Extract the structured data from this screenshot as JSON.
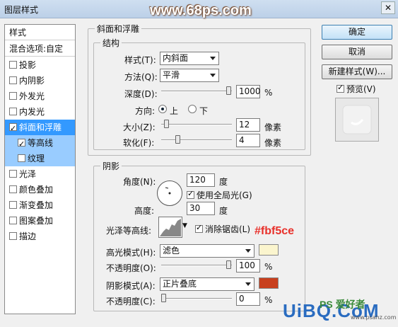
{
  "window": {
    "title": "图层样式",
    "watermark_top": "www.68ps.com",
    "close_glyph": "✕"
  },
  "left": {
    "header": "样式",
    "blend": "混合选项:自定",
    "items": [
      {
        "label": "投影",
        "checked": false
      },
      {
        "label": "内阴影",
        "checked": false
      },
      {
        "label": "外发光",
        "checked": false
      },
      {
        "label": "内发光",
        "checked": false
      },
      {
        "label": "斜面和浮雕",
        "checked": true
      },
      {
        "label": "等高线",
        "checked": true
      },
      {
        "label": "纹理",
        "checked": false
      },
      {
        "label": "光泽",
        "checked": false
      },
      {
        "label": "颜色叠加",
        "checked": false
      },
      {
        "label": "渐变叠加",
        "checked": false
      },
      {
        "label": "图案叠加",
        "checked": false
      },
      {
        "label": "描边",
        "checked": false
      }
    ]
  },
  "buttons": {
    "ok": "确定",
    "cancel": "取消",
    "new_style": "新建样式(W)...",
    "preview": "预览(V)"
  },
  "bevel": {
    "section_title": "斜面和浮雕",
    "structure_title": "结构",
    "style_label": "样式(T):",
    "style_value": "内斜面",
    "method_label": "方法(Q):",
    "method_value": "平滑",
    "depth_label": "深度(D):",
    "depth_value": "1000",
    "depth_unit": "%",
    "depth_level": 1.0,
    "direction_label": "方向:",
    "dir_up": "上",
    "dir_down": "下",
    "size_label": "大小(Z):",
    "size_value": "12",
    "size_unit": "像素",
    "soften_label": "软化(F):",
    "soften_value": "4",
    "soften_unit": "像素"
  },
  "shading": {
    "title": "阴影",
    "angle_label": "角度(N):",
    "angle_value": "120",
    "angle_unit": "度",
    "global_light": "使用全局光(G)",
    "altitude_label": "高度:",
    "altitude_value": "30",
    "altitude_unit": "度",
    "gloss_label": "光泽等高线:",
    "anti_alias": "消除锯齿(L)",
    "highlight_label": "高光模式(H):",
    "highlight_mode": "滤色",
    "highlight_color": "#fbf5ce",
    "opacity1_label": "不透明度(O):",
    "opacity1_value": "100",
    "opacity1_unit": "%",
    "shadow_label": "阴影模式(A):",
    "shadow_mode": "正片叠底",
    "shadow_color": "#c8401e",
    "opacity2_label": "不透明度(C):",
    "opacity2_value": "0",
    "opacity2_unit": "%"
  },
  "annotations": {
    "color_note": "#fbf5ce",
    "wm_bottom": "UiBQ.CoM",
    "wm_ps": "PS 爱好者",
    "wm_url": "www.psahz.com"
  }
}
